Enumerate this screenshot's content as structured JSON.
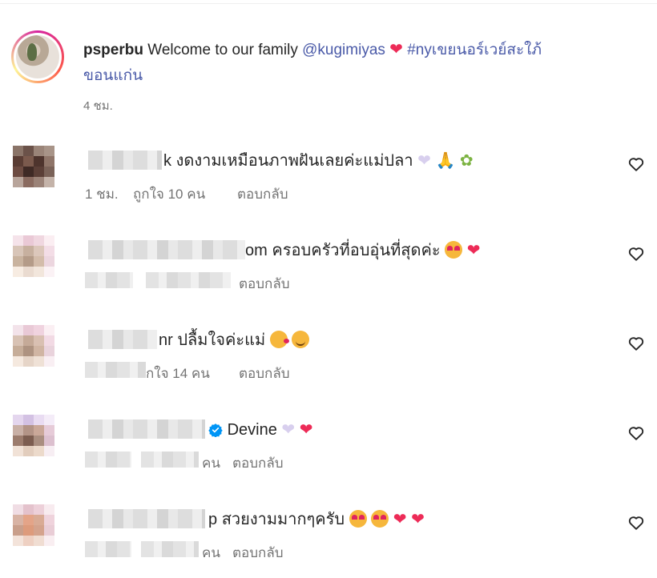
{
  "post": {
    "username": "psperbu",
    "caption_text": "Welcome to our family",
    "mention": "@kugimiyas",
    "hashtag_line1": "#nyเขยนอร์เวย์สะใภ้",
    "hashtag_line2": "ขอนแก่น",
    "time": "4 ชม."
  },
  "comments": [
    {
      "visible_user_fragment": "k",
      "text": "งดงามเหมือนภาพฝันเลยค่ะแม่ปลา",
      "time": "1 ชม.",
      "likes": "ถูกใจ 10 คน",
      "reply": "ตอบกลับ"
    },
    {
      "visible_user_fragment": "om",
      "text": "ครอบครัวที่อบอุ่นที่สุดค่ะ",
      "reply": "ตอบกลับ"
    },
    {
      "visible_user_fragment": "nr",
      "text": "ปลื้มใจค่ะแม่",
      "likes": "กใจ 14 คน",
      "reply": "ตอบกลับ"
    },
    {
      "text": "Devine",
      "likes": "คน",
      "reply": "ตอบกลับ"
    },
    {
      "visible_user_fragment": "p",
      "text": "สวยงามมากๆครับ",
      "likes": "คน",
      "reply": "ตอบกลับ"
    }
  ],
  "icons": {
    "like": "heart-outline-icon",
    "verified": "verified-badge-icon"
  },
  "colors": {
    "link": "#4a5aa8",
    "heart": "#ed2b57",
    "muted": "#737373",
    "verified": "#0095f6"
  }
}
